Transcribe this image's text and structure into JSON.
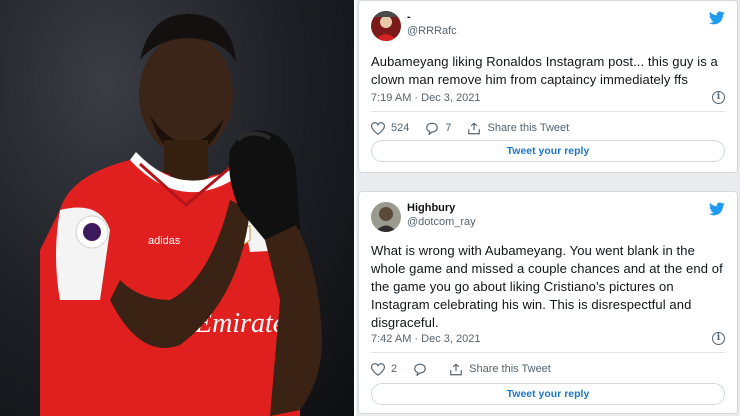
{
  "tweets": [
    {
      "name": "-",
      "handle": "@RRRafc",
      "text": "Aubameyang liking Ronaldos Instagram post... this guy is a clown man remove him from captaincy immediately ffs",
      "time": "7:19 AM · Dec 3, 2021",
      "likes": "524",
      "replies": "7",
      "share_label": "Share this Tweet",
      "reply_button": "Tweet your reply",
      "info_glyph": "i"
    },
    {
      "name": "Highbury",
      "handle": "@dotcom_ray",
      "text": "What is wrong with Aubameyang. You went blank in the whole game and missed a couple chances and at the end of the game you go about liking Cristiano’s pictures on Instagram celebrating his win.  This is disrespectful and disgraceful.",
      "time": "7:42 AM · Dec 3, 2021",
      "likes": "2",
      "replies": "",
      "share_label": "Share this Tweet",
      "reply_button": "Tweet your reply",
      "info_glyph": "i"
    }
  ],
  "photo": {
    "shirt_text": "Emirates",
    "kit_logo": "adidas"
  },
  "colors": {
    "twitter_blue": "#1d9bf0",
    "arsenal_red": "#e0201e",
    "link_blue": "#1d77c7"
  },
  "icons": [
    "twitter-bird-icon",
    "heart-icon",
    "reply-icon",
    "share-icon",
    "info-icon"
  ]
}
